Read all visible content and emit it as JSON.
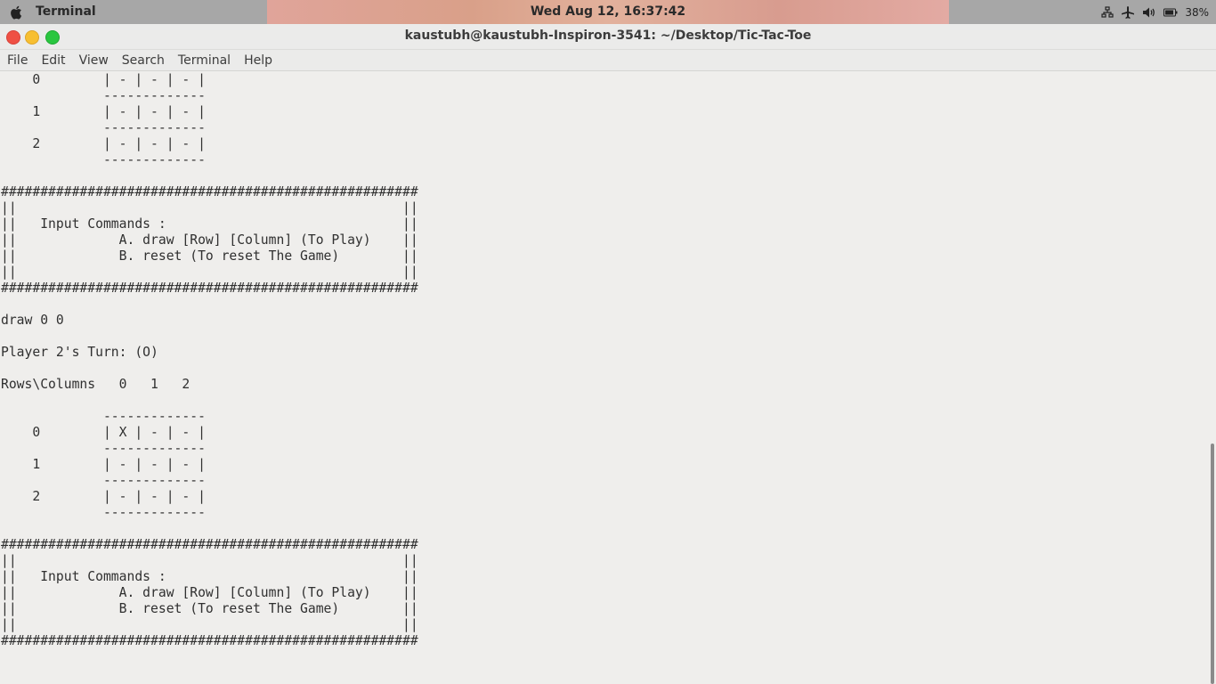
{
  "topbar": {
    "app_name": "Terminal",
    "datetime": "Wed Aug 12, 16:37:42",
    "battery": "38%",
    "icons": [
      "apple-icon",
      "network-icon",
      "airplane-icon",
      "volume-icon",
      "battery-icon"
    ]
  },
  "window": {
    "title": "kaustubh@kaustubh-Inspiron-3541: ~/Desktop/Tic-Tac-Toe"
  },
  "menu": {
    "file": "File",
    "edit": "Edit",
    "view": "View",
    "search": "Search",
    "terminal": "Terminal",
    "help": "Help"
  },
  "terminal": {
    "output": "    0        | - | - | - |\n             -------------\n    1        | - | - | - |\n             -------------\n    2        | - | - | - |\n             -------------\n\n#####################################################\n||                                                 ||\n||   Input Commands :                              ||\n||             A. draw [Row] [Column] (To Play)    ||\n||             B. reset (To reset The Game)        ||\n||                                                 ||\n#####################################################\n\ndraw 0 0\n\nPlayer 2's Turn: (O)\n\nRows\\Columns   0   1   2\n\n             -------------\n    0        | X | - | - |\n             -------------\n    1        | - | - | - |\n             -------------\n    2        | - | - | - |\n             -------------\n\n#####################################################\n||                                                 ||\n||   Input Commands :                              ||\n||             A. draw [Row] [Column] (To Play)    ||\n||             B. reset (To reset The Game)        ||\n||                                                 ||\n#####################################################\n\n\n_"
  }
}
